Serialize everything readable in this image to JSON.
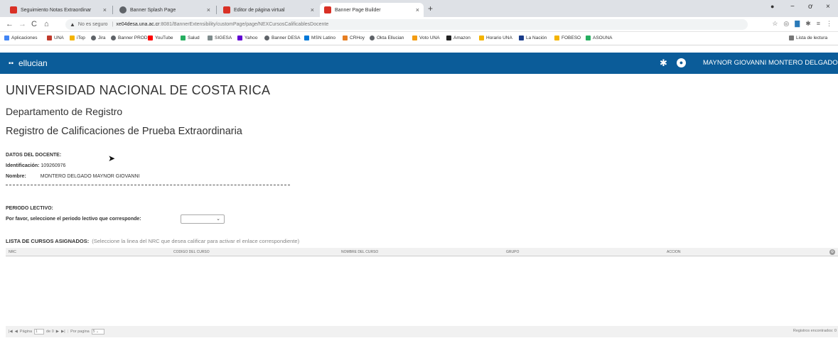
{
  "browser": {
    "tabs": [
      {
        "title": "Seguimiento Notas Extraordinar",
        "color": "#d93025"
      },
      {
        "title": "Banner Splash Page",
        "color": "#5f6368"
      },
      {
        "title": "Editor de página virtual",
        "color": "#d93025"
      },
      {
        "title": "Banner Page Builder",
        "color": "#d93025"
      }
    ],
    "new_tab": "+",
    "address": {
      "security": "No es seguro",
      "url_host": "xe04desa.una.ac.cr",
      "url_rest": ":8081/BannerExtensibility/customPage/page/NEXCursosCalificablesDocente"
    },
    "bookmarks": [
      {
        "label": "Aplicaciones",
        "color": "#4285f4"
      },
      {
        "label": "UNA",
        "color": "#c0392b"
      },
      {
        "label": "iTop",
        "color": "#f4b400"
      },
      {
        "label": "Jira",
        "color": "#5f6368"
      },
      {
        "label": "Banner PROD",
        "color": "#5f6368"
      },
      {
        "label": "YouTube",
        "color": "#ff0000"
      },
      {
        "label": "Salud",
        "color": "#27ae60"
      },
      {
        "label": "SIGESA",
        "color": "#7f8c8d"
      },
      {
        "label": "Yahoo",
        "color": "#6001d2"
      },
      {
        "label": "Banner DESA",
        "color": "#5f6368"
      },
      {
        "label": "MSN Latino",
        "color": "#0078d7"
      },
      {
        "label": "CRHoy",
        "color": "#e67e22"
      },
      {
        "label": "Okta Ellucian",
        "color": "#5f6368"
      },
      {
        "label": "Voto UNA",
        "color": "#f39c12"
      },
      {
        "label": "Amazon",
        "color": "#222222"
      },
      {
        "label": "Horario UNA",
        "color": "#f4b400"
      },
      {
        "label": "La Nación",
        "color": "#1a3c8a"
      },
      {
        "label": "FOBESO",
        "color": "#f4b400"
      },
      {
        "label": "ASOUNA",
        "color": "#27ae60"
      }
    ],
    "reading_list": "Lista de lectura"
  },
  "app": {
    "brand": "ellucian",
    "user_name": "MAYNOR GIOVANNI MONTERO DELGADO"
  },
  "page": {
    "university": "UNIVERSIDAD NACIONAL DE COSTA RICA",
    "department": "Departamento de Registro",
    "title": "Registro de Calificaciones de Prueba Extraordinaria",
    "docente_header": "DATOS DEL DOCENTE:",
    "identificacion_label": "Identificación:",
    "identificacion_value": "109260976",
    "nombre_label": "Nombre:",
    "nombre_value": "MONTERO DELGADO MAYNOR GIOVANNI",
    "periodo_header": "PERIODO LECTIVO:",
    "periodo_prompt": "Por favor, seleccione el periodo lectivo que corresponde:",
    "periodo_selected": "",
    "lista_header": "LISTA DE CURSOS ASIGNADOS:",
    "lista_hint": "(Seleccione la linea del NRC que desea calificar para activar el enlace correspondiente)"
  },
  "grid": {
    "columns": [
      "NRC",
      "CODIGO DEL CURSO",
      "NOMBRE DEL CURSO",
      "GRUPO",
      "ACCION"
    ],
    "rows": []
  },
  "pager": {
    "page_label": "Página",
    "page_value": "1",
    "of_label": "de 0",
    "per_page_label": "Por pagina",
    "per_page_value": "5",
    "records": "Registros encontrados: 0"
  }
}
